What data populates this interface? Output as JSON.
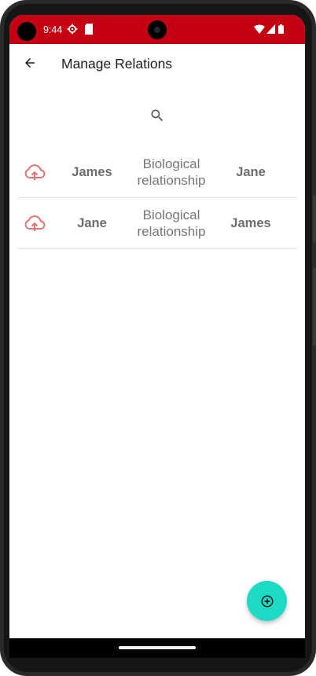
{
  "status_bar": {
    "time": "9:44",
    "background_color": "#c40112",
    "icons": [
      "settings-gear-icon",
      "sd-card-icon",
      "wifi-icon",
      "cell-signal-icon",
      "battery-icon"
    ]
  },
  "app_bar": {
    "back_icon": "arrow-back-icon",
    "title": "Manage Relations"
  },
  "search": {
    "icon": "search-icon"
  },
  "relations": [
    {
      "sync_icon": "cloud-upload-icon",
      "person1": "James",
      "relationship": "Biological relationship",
      "person2": "Jane"
    },
    {
      "sync_icon": "cloud-upload-icon",
      "person1": "Jane",
      "relationship": "Biological relationship",
      "person2": "James"
    }
  ],
  "fab": {
    "icon": "add-circle-icon",
    "color": "#1ed9c4"
  },
  "colors": {
    "accent_red": "#c40112",
    "cloud_icon": "#e07474",
    "text_gray": "#6d6d6d"
  }
}
